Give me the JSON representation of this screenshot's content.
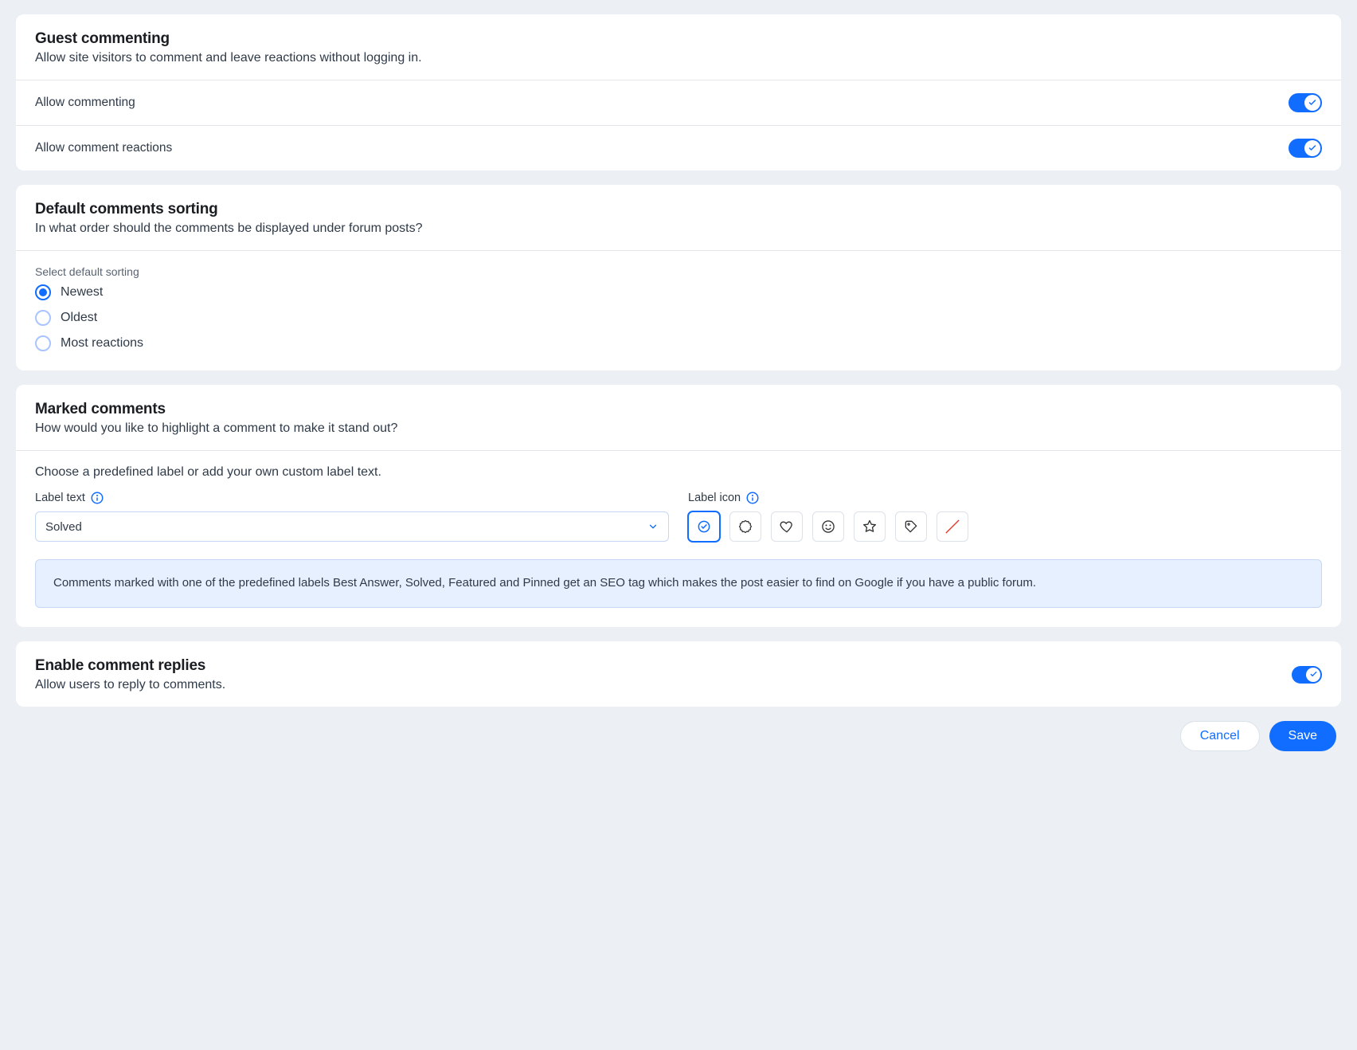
{
  "guest": {
    "title": "Guest commenting",
    "desc": "Allow site visitors to comment and leave reactions without logging in.",
    "allow_commenting_label": "Allow commenting",
    "allow_commenting_on": true,
    "allow_reactions_label": "Allow comment reactions",
    "allow_reactions_on": true
  },
  "sorting": {
    "title": "Default comments sorting",
    "desc": "In what order should the comments be displayed under forum posts?",
    "select_label": "Select default sorting",
    "options": [
      "Newest",
      "Oldest",
      "Most reactions"
    ],
    "selected_index": 0
  },
  "marked": {
    "title": "Marked comments",
    "desc": "How would you like to highlight a comment to make it stand out?",
    "choose_label": "Choose a predefined label or add your own custom label text.",
    "label_text_label": "Label text",
    "label_text_value": "Solved",
    "label_icon_label": "Label icon",
    "icons": [
      "check-badge",
      "ribbon-badge",
      "heart",
      "smiley",
      "star",
      "tag",
      "none"
    ],
    "selected_icon_index": 0,
    "notice": "Comments marked with one of the predefined labels Best Answer, Solved, Featured and Pinned get an SEO tag which makes the post easier to find on Google if you have a public forum."
  },
  "replies": {
    "title": "Enable comment replies",
    "desc": "Allow users to reply to comments.",
    "on": true
  },
  "footer": {
    "cancel": "Cancel",
    "save": "Save"
  }
}
